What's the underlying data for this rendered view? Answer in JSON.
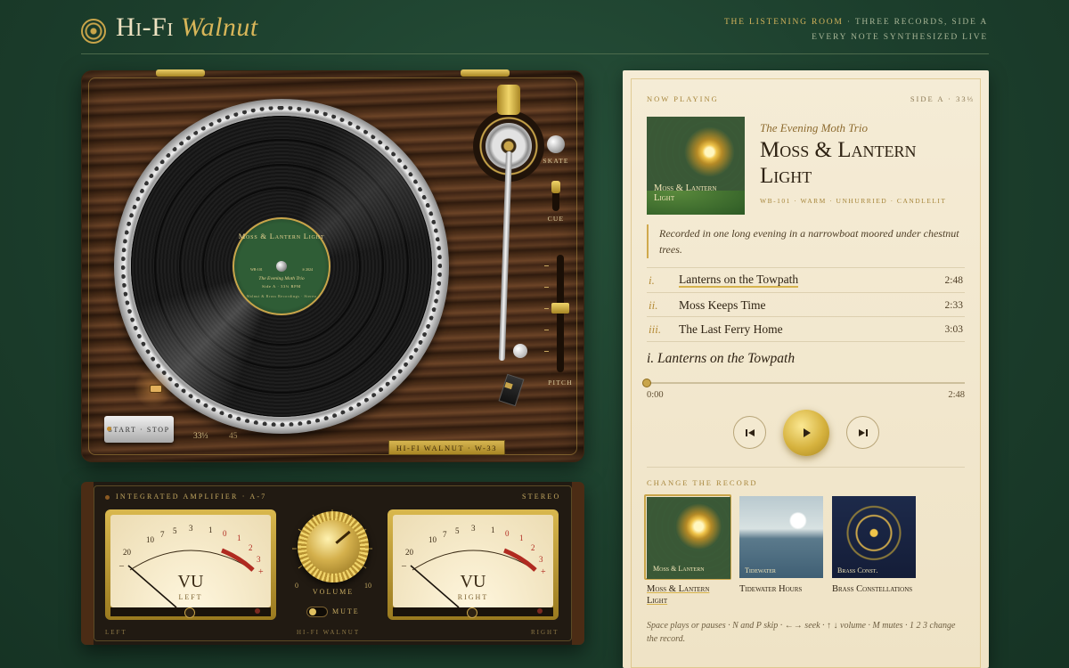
{
  "header": {
    "brand_main": "Hi-Fi",
    "brand_accent": "Walnut",
    "tagline_highlight": "The listening room",
    "tagline_rest": " · Three records, side A",
    "tagline_line2": "Every note synthesized live"
  },
  "turntable": {
    "label_title": "Moss & Lantern Light",
    "label_artist": "The Evening Moth Trio",
    "label_side": "Side A · 33⅓ RPM",
    "label_footer": "Walnut & Brass Recordings · Stereo",
    "label_code_left": "WB-101",
    "label_code_right": "℗ 2024",
    "skate_label": "Skate",
    "cue_label": "Cue",
    "pitch_label": "Pitch",
    "start_stop_label": "Start · Stop",
    "speed_33": "33⅓",
    "speed_45": "45",
    "badge": "Hi-Fi Walnut · W-33"
  },
  "amplifier": {
    "title": "Integrated Amplifier · A-7",
    "stereo": "Stereo",
    "meter_left": {
      "face": "VU",
      "side": "Left"
    },
    "meter_right": {
      "face": "VU",
      "side": "Right"
    },
    "scale": [
      "20",
      "10",
      "7",
      "5",
      "3",
      "1",
      "0",
      "1",
      "2",
      "3"
    ],
    "minus": "–",
    "plus": "+",
    "volume_label": "Volume",
    "volume_min": "0",
    "volume_max": "10",
    "mute_label": "Mute",
    "footer_left": "Left",
    "footer_brand": "Hi-Fi Walnut",
    "footer_right": "Right"
  },
  "player": {
    "now_playing": "Now playing",
    "side": "Side A · 33⅓",
    "cover_title": "Moss & Lantern Light",
    "artist": "The Evening Moth Trio",
    "album": "Moss & Lantern Light",
    "meta": "WB-101 · warm · unhurried · candlelit",
    "quote": "Recorded in one long evening in a narrowboat moored under chestnut trees.",
    "tracks": [
      {
        "num": "i.",
        "title": "Lanterns on the Towpath",
        "time": "2:48"
      },
      {
        "num": "ii.",
        "title": "Moss Keeps Time",
        "time": "2:33"
      },
      {
        "num": "iii.",
        "title": "The Last Ferry Home",
        "time": "3:03"
      }
    ],
    "current": "i. Lanterns on the Towpath",
    "time_current": "0:00",
    "time_total": "2:48",
    "progress": 0,
    "icons": {
      "prev": "skip-previous-icon",
      "play": "play-icon",
      "next": "skip-next-icon"
    },
    "change_label": "Change the record",
    "records": [
      {
        "art_title": "Moss & Lantern",
        "name": "Moss & Lantern Light",
        "selected": true
      },
      {
        "art_title": "Tidewater",
        "name": "Tidewater Hours",
        "selected": false
      },
      {
        "art_title": "Brass Const.",
        "name": "Brass Constellations",
        "selected": false
      }
    ],
    "hint": "Space plays or pauses · N and P skip · ←→ seek · ↑ ↓ volume · M mutes · 1 2 3 change the record."
  },
  "colors": {
    "gold": "#c9a54a",
    "forest": "#1c3e2c",
    "cream": "#f5ecd6",
    "walnut": "#5d3a21"
  }
}
